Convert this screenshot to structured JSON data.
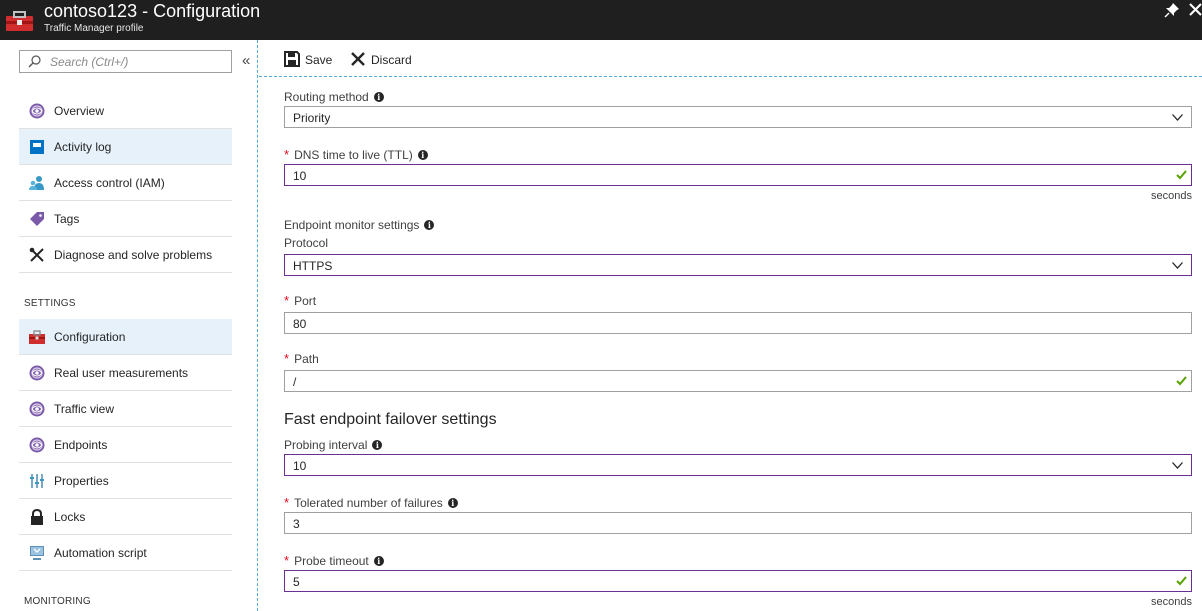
{
  "window": {
    "title": "contoso123 - Configuration",
    "subtitle": "Traffic Manager profile"
  },
  "sidebar": {
    "search_placeholder": "Search (Ctrl+/)",
    "collapse_glyph": "«",
    "items": [
      {
        "label": "Overview",
        "icon": "traffic-manager-icon"
      },
      {
        "label": "Activity log",
        "icon": "activity-log-icon"
      },
      {
        "label": "Access control (IAM)",
        "icon": "iam-icon"
      },
      {
        "label": "Tags",
        "icon": "tag-icon"
      },
      {
        "label": "Diagnose and solve problems",
        "icon": "wrench-icon"
      }
    ],
    "settings_header": "SETTINGS",
    "settings_items": [
      {
        "label": "Configuration",
        "icon": "toolbox-icon"
      },
      {
        "label": "Real user measurements",
        "icon": "traffic-manager-icon"
      },
      {
        "label": "Traffic view",
        "icon": "traffic-manager-icon"
      },
      {
        "label": "Endpoints",
        "icon": "traffic-manager-icon"
      },
      {
        "label": "Properties",
        "icon": "properties-icon"
      },
      {
        "label": "Locks",
        "icon": "lock-icon"
      },
      {
        "label": "Automation script",
        "icon": "automation-icon"
      }
    ],
    "monitoring_header": "MONITORING"
  },
  "toolbar": {
    "save_label": "Save",
    "discard_label": "Discard"
  },
  "form": {
    "routing_method": {
      "label": "Routing method",
      "value": "Priority"
    },
    "dns_ttl": {
      "label": "DNS time to live (TTL)",
      "value": "10",
      "unit": "seconds"
    },
    "endpoint_monitor": {
      "label": "Endpoint monitor settings"
    },
    "protocol": {
      "label": "Protocol",
      "value": "HTTPS"
    },
    "port": {
      "label": "Port",
      "value": "80"
    },
    "path": {
      "label": "Path",
      "value": "/"
    },
    "failover_title": "Fast endpoint failover settings",
    "probing_interval": {
      "label": "Probing interval",
      "value": "10"
    },
    "tolerated_failures": {
      "label": "Tolerated number of failures",
      "value": "3"
    },
    "probe_timeout": {
      "label": "Probe timeout",
      "value": "5",
      "unit": "seconds"
    }
  },
  "colors": {
    "titlebar_bg": "#1f1f1f",
    "selected_nav_bg": "#e6f1fa",
    "active_field_border": "#6a2f8f",
    "required_asterisk": "#e00b1c",
    "valid_check": "#57a300"
  }
}
